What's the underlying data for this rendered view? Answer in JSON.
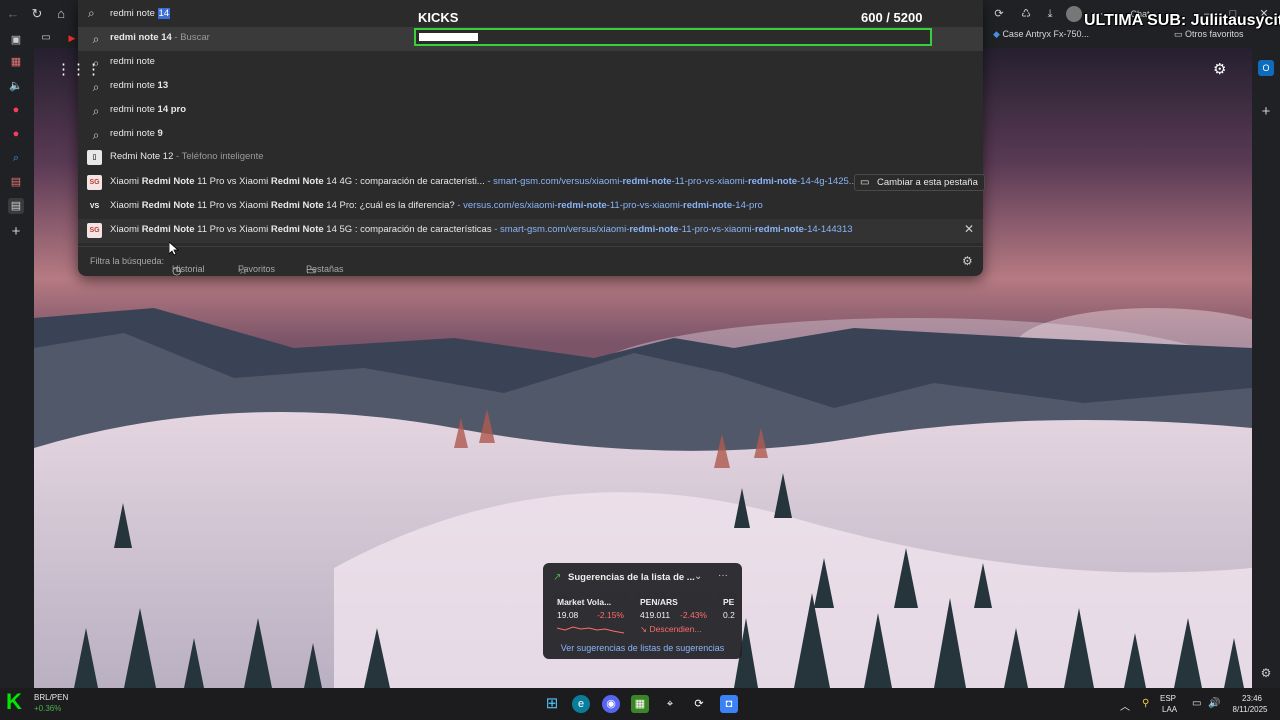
{
  "address": {
    "query_plain": "redmi note ",
    "query_selected": "14"
  },
  "suggestions": [
    {
      "bold": "redmi note 14",
      "suffix": " - Buscar",
      "icon": "search-icon"
    },
    {
      "plain": "redmi note",
      "icon": "search-icon"
    },
    {
      "plain": "redmi note ",
      "bold": "13",
      "icon": "search-icon"
    },
    {
      "plain": "redmi note ",
      "bold": "14 pro",
      "icon": "search-icon"
    },
    {
      "plain": "redmi note ",
      "bold": "9",
      "icon": "search-icon"
    },
    {
      "plain": "Redmi Note 12",
      "suffix": " - Teléfono inteligente",
      "icon": "phone-thumbnail-icon"
    }
  ],
  "results": [
    {
      "p1": "Xiaomi ",
      "b1": "Redmi Note",
      "p2": " 11 Pro vs Xiaomi ",
      "b2": "Redmi Note",
      "p3": " 14 4G : comparación de característi...",
      "url_pre": " - smart-gsm.com/versus/xiaomi-",
      "url_b1": "redmi-note",
      "url_mid": "-11-pro-vs-xiaomi-",
      "url_b2": "redmi-note",
      "url_post": "-14-4g-1425...",
      "site_badge": "SG"
    },
    {
      "p1": "Xiaomi ",
      "b1": "Redmi Note",
      "p2": " 11 Pro vs Xiaomi ",
      "b2": "Redmi Note",
      "p3": " 14 Pro: ¿cuál es la diferencia?",
      "url_pre": " - versus.com/es/xiaomi-",
      "url_b1": "redmi-note",
      "url_mid": "-11-pro-vs-xiaomi-",
      "url_b2": "redmi-note",
      "url_post": "-14-pro",
      "site_badge": "VS"
    },
    {
      "p1": "Xiaomi ",
      "b1": "Redmi Note",
      "p2": " 11 Pro vs Xiaomi ",
      "b2": "Redmi Note",
      "p3": " 14 5G : comparación de características",
      "url_pre": " - smart-gsm.com/versus/xiaomi-",
      "url_b1": "redmi-note",
      "url_mid": "-11-pro-vs-xiaomi-",
      "url_b2": "redmi-note",
      "url_post": "-14-144313",
      "site_badge": "SG"
    }
  ],
  "switch_tab_label": "Cambiar a esta pestaña",
  "filter": {
    "label": "Filtra la búsqueda:",
    "history": "Historial",
    "favorites": "Favoritos",
    "tabs": "Pestañas"
  },
  "kicks": {
    "title": "KICKS",
    "count": "600  / 5200",
    "progress": 0.115,
    "accent": "#38d03a"
  },
  "overlay_text": "ULTIMA SUB: Juliitausycita",
  "top_bar": {
    "chat_label": "Chat"
  },
  "favorites_bar": {
    "item1": "Case Antryx Fx-750...",
    "other": "Otros favoritos"
  },
  "widget": {
    "title": "Sugerencias de la lista de ...",
    "cards": [
      {
        "name": "Market Vola...",
        "value": "19.08",
        "change": "-2.15%"
      },
      {
        "name": "PEN/ARS",
        "value": "419.011",
        "change": "-2.43%",
        "sub": "Descendien..."
      },
      {
        "name": "PE",
        "value": "0.2"
      }
    ],
    "link": "Ver sugerencias de listas de sugerencias"
  },
  "taskbar": {
    "ticker_name": "BRL/PEN",
    "ticker_change": "+0.36%",
    "lang1": "ESP",
    "lang2": "LAA",
    "time": "23:46",
    "date": "8/11/2025"
  }
}
